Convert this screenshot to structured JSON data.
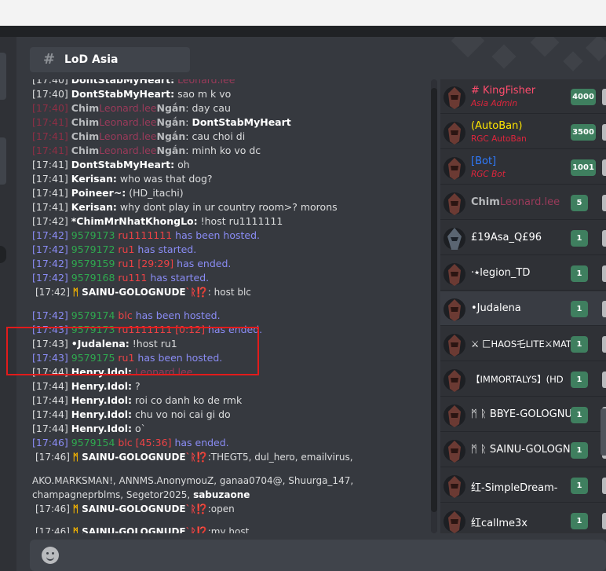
{
  "channel": {
    "name": "LoD Asia",
    "icon": "hash-icon"
  },
  "messages": [
    {
      "ts": "[17:40]",
      "user": "DontStabMyHeart:",
      "text": "",
      "extra": "Leonard.lee"
    },
    {
      "ts": "[17:40]",
      "user": "DontStabMyHeart:",
      "text": "sao m k vo"
    },
    {
      "ts": "[17:40]",
      "user": "Chim",
      "extra": "Leonard.lee",
      "user2": "Ngắn",
      "text": "day cau"
    },
    {
      "ts": "[17:41]",
      "user": "Chim",
      "extra": "Leonard.lee",
      "user2": "Ngắn",
      "text": "DontStabMyHeart"
    },
    {
      "ts": "[17:41]",
      "user": "Chim",
      "extra": "Leonard.lee",
      "user2": "Ngắn",
      "text": "cau choi di"
    },
    {
      "ts": "[17:41]",
      "user": "Chim",
      "extra": "Leonard.lee",
      "user2": "Ngắn",
      "text": "minh ko vo dc"
    },
    {
      "ts": "[17:41]",
      "user": "DontStabMyHeart:",
      "text": "oh"
    },
    {
      "ts": "[17:41]",
      "user": "Kerisan:",
      "text": "who was that dog?"
    },
    {
      "ts": "[17:41]",
      "user": "Poineer~:",
      "text": "(HD_itachi)"
    },
    {
      "ts": "[17:41]",
      "user": "Kerisan:",
      "text": "why dont play in ur country room>? morons"
    },
    {
      "ts": "[17:42]",
      "user": "*ChimMrNhatKhongLo:",
      "text": "!host ru1111111"
    },
    {
      "ts": "[17:42]",
      "id": "9579173",
      "game": "ru1111111",
      "text": "has been hosted."
    },
    {
      "ts": "[17:42]",
      "id": "9579172",
      "game": "ru1",
      "text": "has started."
    },
    {
      "ts": "[17:42]",
      "id": "9579159",
      "game": "ru1 [29:29]",
      "text": "has ended."
    },
    {
      "ts": "[17:42]",
      "id": "9579168",
      "game": "ru111",
      "text": "has started."
    },
    {
      "ts": "[17:42]",
      "user": "SAINU-GOLOGNUDE",
      "prefix": "ᛗ ",
      "suffix": "`ᚱ⁉️",
      "text": ": host blc"
    },
    {
      "ts": "[17:42]",
      "id": "9579174",
      "game": "blc",
      "text": "has been hosted."
    },
    {
      "ts": "[17:43]",
      "id": "9579173",
      "game": "ru1111111 [0:12]",
      "text": "has ended."
    },
    {
      "ts": "[17:43]",
      "user": "•Judalena:",
      "text": "!host ru1"
    },
    {
      "ts": "[17:43]",
      "id": "9579175",
      "game": "ru1",
      "text": "has been hosted."
    },
    {
      "ts": "[17:44]",
      "user": "Henry.Idol:",
      "extra": "Leonard.lee"
    },
    {
      "ts": "[17:44]",
      "user": "Henry.Idol:",
      "text": "?"
    },
    {
      "ts": "[17:44]",
      "user": "Henry.Idol:",
      "text": "roi co danh ko de rmk"
    },
    {
      "ts": "[17:44]",
      "user": "Henry.Idol:",
      "text": "chu vo noi cai gi do"
    },
    {
      "ts": "[17:44]",
      "user": "Henry.Idol:",
      "text": "o`"
    },
    {
      "ts": "[17:46]",
      "id": "9579154",
      "game": "blc [45:36]",
      "text": "has ended."
    },
    {
      "ts": "[17:46]",
      "user": "SAINU-GOLOGNUDE",
      "prefix": "ᛗ ",
      "suffix": "`ᚱ⁉️",
      "text": ":THEGT5, dul_hero, emailvirus,"
    },
    {
      "text": "AKO.MARKSMAN!, ANNMS.AnonymouZ, ganaa0704@, Shuurga_147,"
    },
    {
      "text": "champagneprblms, Segetor2025,",
      "user": "sabuzaone"
    },
    {
      "ts": "[17:46]",
      "user": "SAINU-GOLOGNUDE",
      "prefix": "ᛗ ",
      "suffix": "`ᚱ⁉️",
      "text": ":open"
    },
    {
      "ts": "[17:46]",
      "user": "SAINU-GOLOGNUDE",
      "prefix": "ᛗ ",
      "suffix": "`ᚱ⁉️",
      "text": ":my host"
    }
  ],
  "members": [
    {
      "name": "# KingFisher",
      "sub": "Asia Admin",
      "count": "4000",
      "name_color": "#ff4d6d",
      "sub_color": "#e0253c"
    },
    {
      "name": "(AutoBan)",
      "sub": "RGC AutoBan",
      "count": "3500",
      "name_color": "#ffe600",
      "sub_color": "#e0253c"
    },
    {
      "name": "[Bot]",
      "sub": "RGC Bot",
      "count": "1001",
      "name_color": "#2f7bff",
      "sub_color": "#e0253c"
    },
    {
      "name": "Chim",
      "extra": "Leonard.lee",
      "count": "5",
      "name_color": "#b9bbbe"
    },
    {
      "name": "£19Asa_Q£96",
      "count": "1",
      "name_color": "#ffffff"
    },
    {
      "name": "·٭legion_TD",
      "count": "1",
      "name_color": "#ffffff"
    },
    {
      "name": "•Judalena",
      "count": "1",
      "name_color": "#ffffff",
      "selected": true
    },
    {
      "name": "⚔ 匚HAOS乇LITE⚔MAT",
      "count": "1",
      "name_color": "#ffffff"
    },
    {
      "name": "【IMMORTALYS】(HD",
      "count": "1",
      "name_color": "#ffffff"
    },
    {
      "name": "ᛗ ᚱ BBYE-GOLOGNU",
      "count": "1",
      "name_color": "#ffffff"
    },
    {
      "name": "ᛗ ᚱ SAINU-GOLOGNU",
      "count": "1",
      "name_color": "#ffffff"
    },
    {
      "name": "红-SimpleDream-",
      "count": "1",
      "name_color": "#ffffff"
    },
    {
      "name": "红callme3x",
      "count": "1",
      "name_color": "#ffffff"
    }
  ]
}
